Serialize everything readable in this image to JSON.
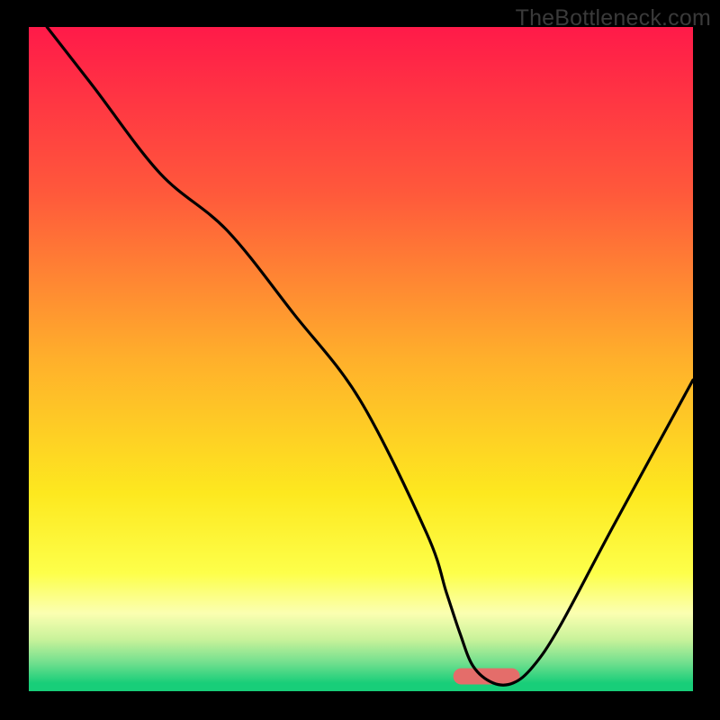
{
  "watermark": "TheBottleneck.com",
  "chart_data": {
    "type": "line",
    "title": "",
    "xlabel": "",
    "ylabel": "",
    "xlim": [
      0,
      100
    ],
    "ylim": [
      0,
      100
    ],
    "grid": false,
    "legend": false,
    "background": {
      "type": "bottleneck-gradient",
      "stops": [
        {
          "offset": 0.0,
          "color": "#ff1a49"
        },
        {
          "offset": 0.25,
          "color": "#ff593b"
        },
        {
          "offset": 0.5,
          "color": "#ffb02b"
        },
        {
          "offset": 0.7,
          "color": "#fde81f"
        },
        {
          "offset": 0.82,
          "color": "#fdff4a"
        },
        {
          "offset": 0.88,
          "color": "#fbffb1"
        },
        {
          "offset": 0.92,
          "color": "#c8f29a"
        },
        {
          "offset": 0.955,
          "color": "#70df8e"
        },
        {
          "offset": 0.985,
          "color": "#18ce79"
        },
        {
          "offset": 1.0,
          "color": "#18ce79"
        }
      ]
    },
    "marker": {
      "color": "#e46d6a",
      "x_center": 69,
      "width": 10,
      "y": 2.5
    },
    "series": [
      {
        "name": "bottleneck-curve",
        "color": "#000000",
        "x": [
          3,
          10,
          20,
          30,
          40,
          50,
          60,
          63,
          65,
          67,
          70,
          73,
          76,
          80,
          88,
          100
        ],
        "y": [
          100,
          91,
          78,
          69.5,
          57,
          44,
          24,
          15,
          9,
          4,
          1.5,
          1.5,
          4,
          10,
          25,
          47
        ]
      }
    ]
  }
}
